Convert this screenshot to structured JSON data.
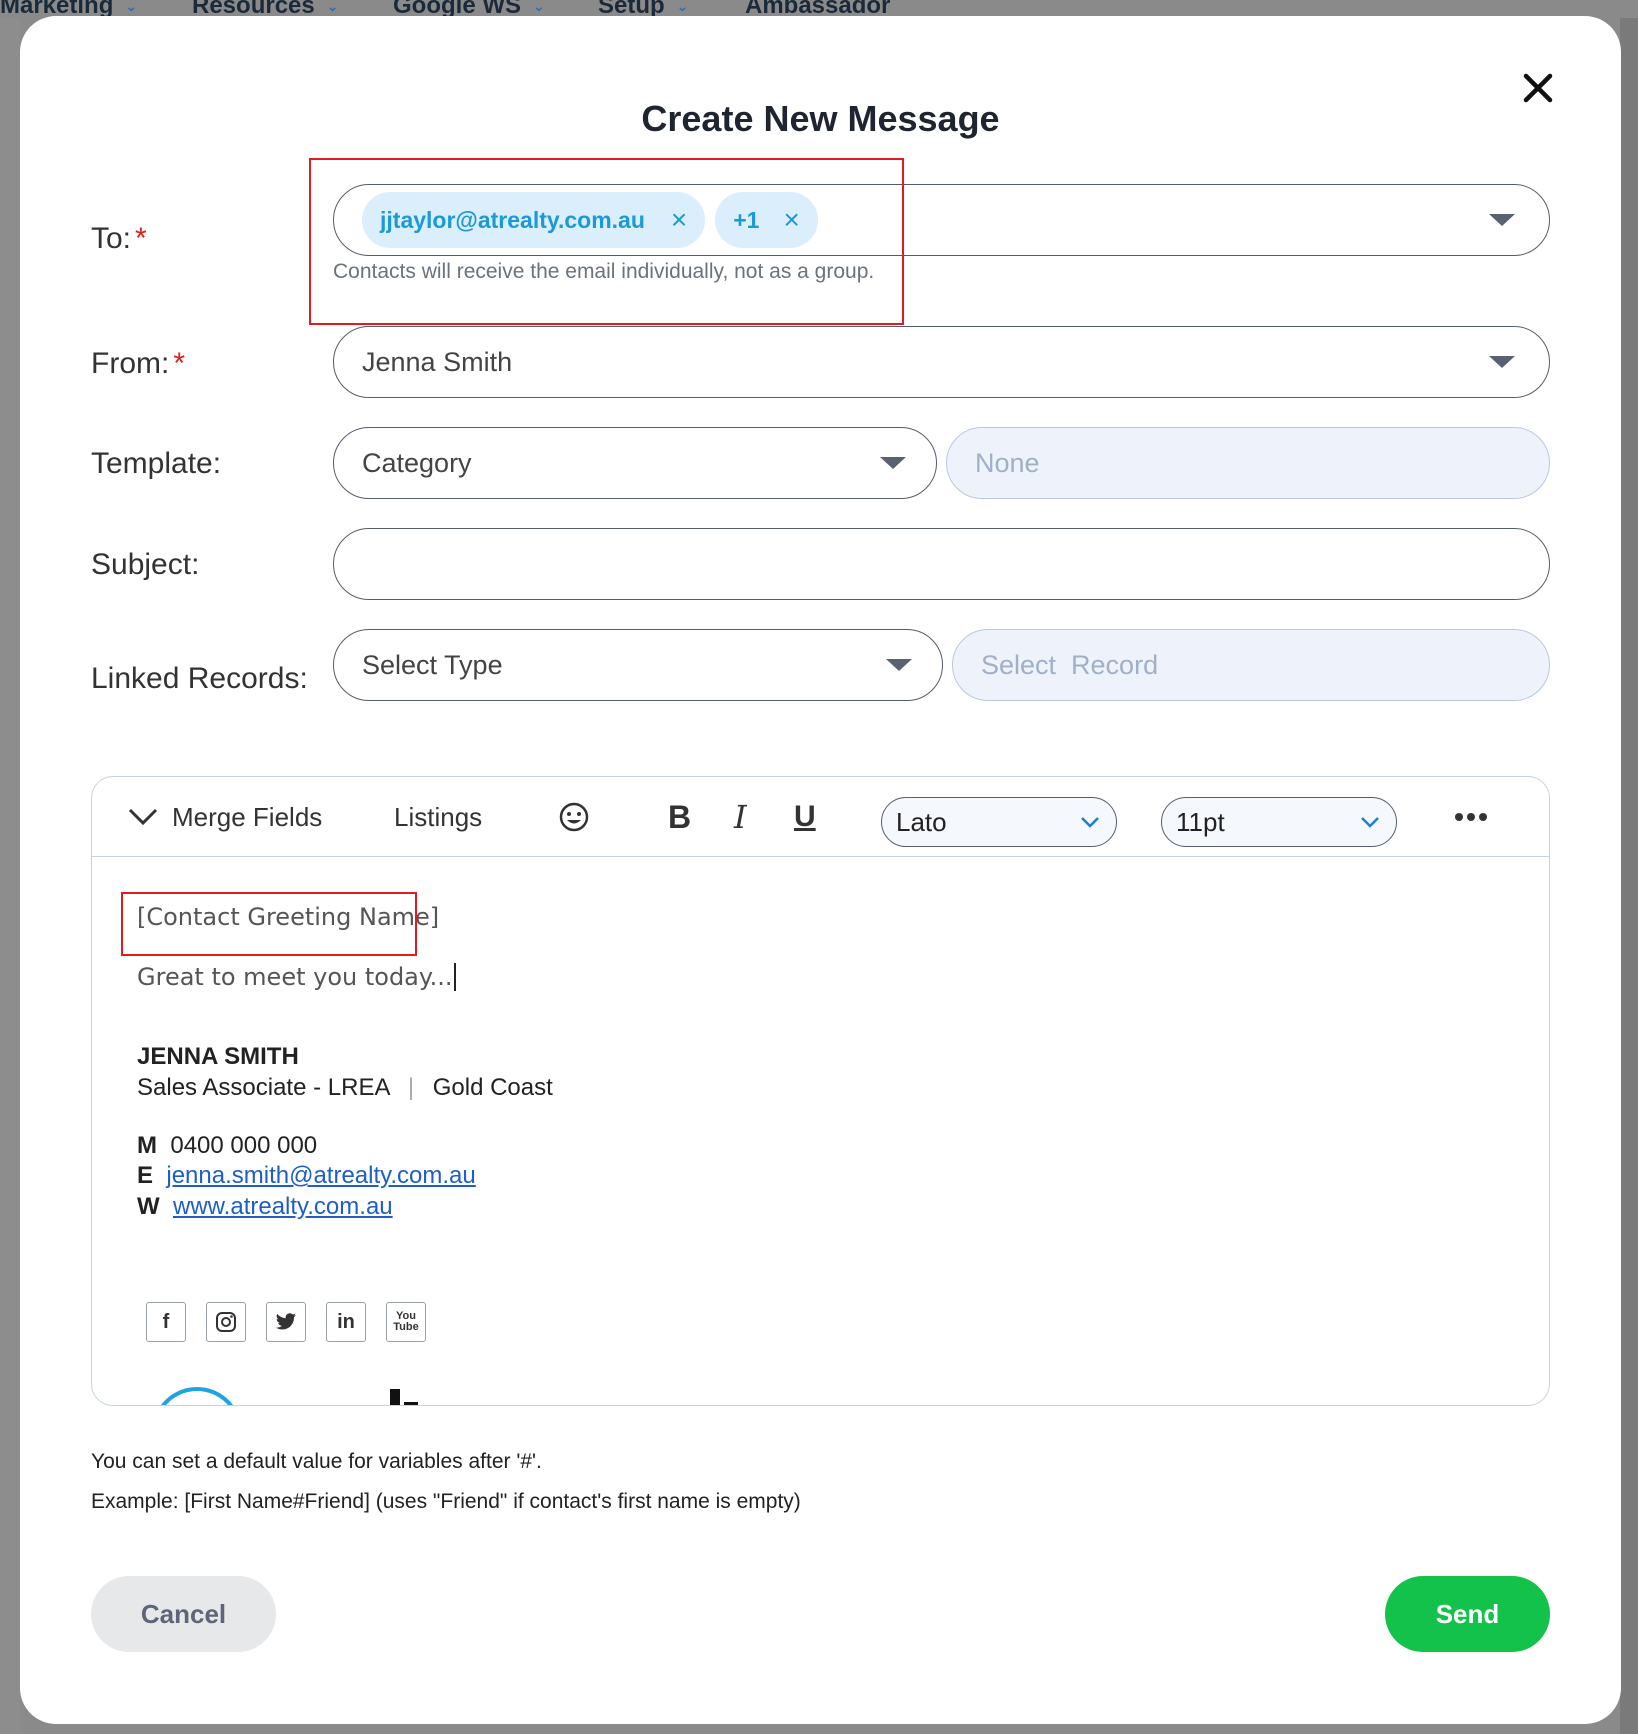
{
  "background_nav": {
    "items": [
      "Marketing",
      "Resources",
      "Google WS",
      "Setup",
      "Ambassador"
    ]
  },
  "modal": {
    "title": "Create New Message",
    "to": {
      "label": "To:",
      "required_mark": "*",
      "chips": [
        {
          "label": "jjtaylor@atrealty.com.au"
        },
        {
          "label": "+1"
        }
      ],
      "hint": "Contacts will receive the email individually, not as a group."
    },
    "from": {
      "label": "From:",
      "required_mark": "*",
      "value": "Jenna Smith"
    },
    "template": {
      "label": "Template:",
      "category_placeholder": "Category",
      "template_value": "None"
    },
    "subject": {
      "label": "Subject:",
      "value": ""
    },
    "linked_records": {
      "label": "Linked Records:",
      "type_placeholder": "Select Type",
      "record_placeholder": "Select  Record"
    },
    "editor": {
      "toolbar": {
        "merge_fields": "Merge Fields",
        "listings": "Listings",
        "bold": "B",
        "italic": "I",
        "underline": "U",
        "font": "Lato",
        "size": "11pt"
      },
      "greeting": "[Contact Greeting Name]",
      "line1": "Great to meet you today...",
      "signature": {
        "name": "JENNA SMITH",
        "role": "Sales Associate - LREA",
        "separator": "|",
        "office": "Gold Coast",
        "m_label": "M",
        "mobile": "0400 000 000",
        "e_label": "E",
        "email": "jenna.smith@atrealty.com.au",
        "w_label": "W",
        "website": "www.atrealty.com.au"
      },
      "social": [
        {
          "icon": "facebook-icon",
          "glyph": "f"
        },
        {
          "icon": "instagram-icon",
          "glyph": "◎"
        },
        {
          "icon": "twitter-icon",
          "glyph": "🐦"
        },
        {
          "icon": "linkedin-icon",
          "glyph": "in"
        },
        {
          "icon": "youtube-icon",
          "glyph": "You"
        }
      ]
    },
    "info_line1": "You can set a default value for variables after '#'.",
    "info_line2": "Example: [First Name#Friend] (uses \"Friend\" if contact's first name is empty)",
    "cancel_label": "Cancel",
    "send_label": "Send"
  },
  "colors": {
    "send": "#12c24a",
    "chip_text": "#1a9ad6",
    "chip_bg": "#dbeefb",
    "highlight_box": "#e11b22"
  }
}
